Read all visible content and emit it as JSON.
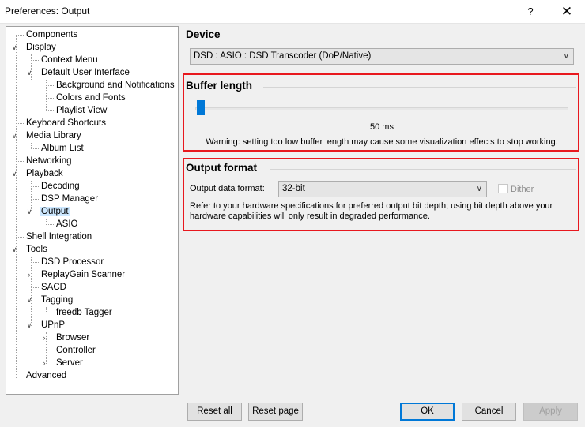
{
  "window": {
    "title": "Preferences: Output",
    "help_glyph": "?",
    "close_glyph": "✕"
  },
  "tree": {
    "items": [
      {
        "label": "Components"
      },
      {
        "label": "Display"
      },
      {
        "label": "Context Menu"
      },
      {
        "label": "Default User Interface"
      },
      {
        "label": "Background and Notifications"
      },
      {
        "label": "Colors and Fonts"
      },
      {
        "label": "Playlist View"
      },
      {
        "label": "Keyboard Shortcuts"
      },
      {
        "label": "Media Library"
      },
      {
        "label": "Album List"
      },
      {
        "label": "Networking"
      },
      {
        "label": "Playback"
      },
      {
        "label": "Decoding"
      },
      {
        "label": "DSP Manager"
      },
      {
        "label": "Output",
        "selected": true
      },
      {
        "label": "ASIO"
      },
      {
        "label": "Shell Integration"
      },
      {
        "label": "Tools"
      },
      {
        "label": "DSD Processor"
      },
      {
        "label": "ReplayGain Scanner"
      },
      {
        "label": "SACD"
      },
      {
        "label": "Tagging"
      },
      {
        "label": "freedb Tagger"
      },
      {
        "label": "UPnP"
      },
      {
        "label": "Browser"
      },
      {
        "label": "Controller"
      },
      {
        "label": "Server"
      },
      {
        "label": "Advanced"
      }
    ]
  },
  "device": {
    "title": "Device",
    "selected": "DSD : ASIO : DSD Transcoder (DoP/Native)"
  },
  "buffer": {
    "title": "Buffer length",
    "value_label": "50 ms",
    "slider_fraction": 0.0,
    "warning": "Warning: setting too low buffer length may cause some visualization effects to stop working."
  },
  "output_format": {
    "title": "Output format",
    "data_format_label": "Output data format:",
    "data_format_value": "32-bit",
    "dither_label": "Dither",
    "dither_checked": false,
    "info": "Refer to your hardware specifications for preferred output bit depth; using bit depth above your hardware capabilities will only result in degraded performance."
  },
  "buttons": {
    "reset_all": "Reset all",
    "reset_page": "Reset page",
    "ok": "OK",
    "cancel": "Cancel",
    "apply": "Apply"
  },
  "colors": {
    "highlight_box": "#e8181e",
    "accent": "#0078d7",
    "selected_item_bg": "#cde8ff"
  }
}
